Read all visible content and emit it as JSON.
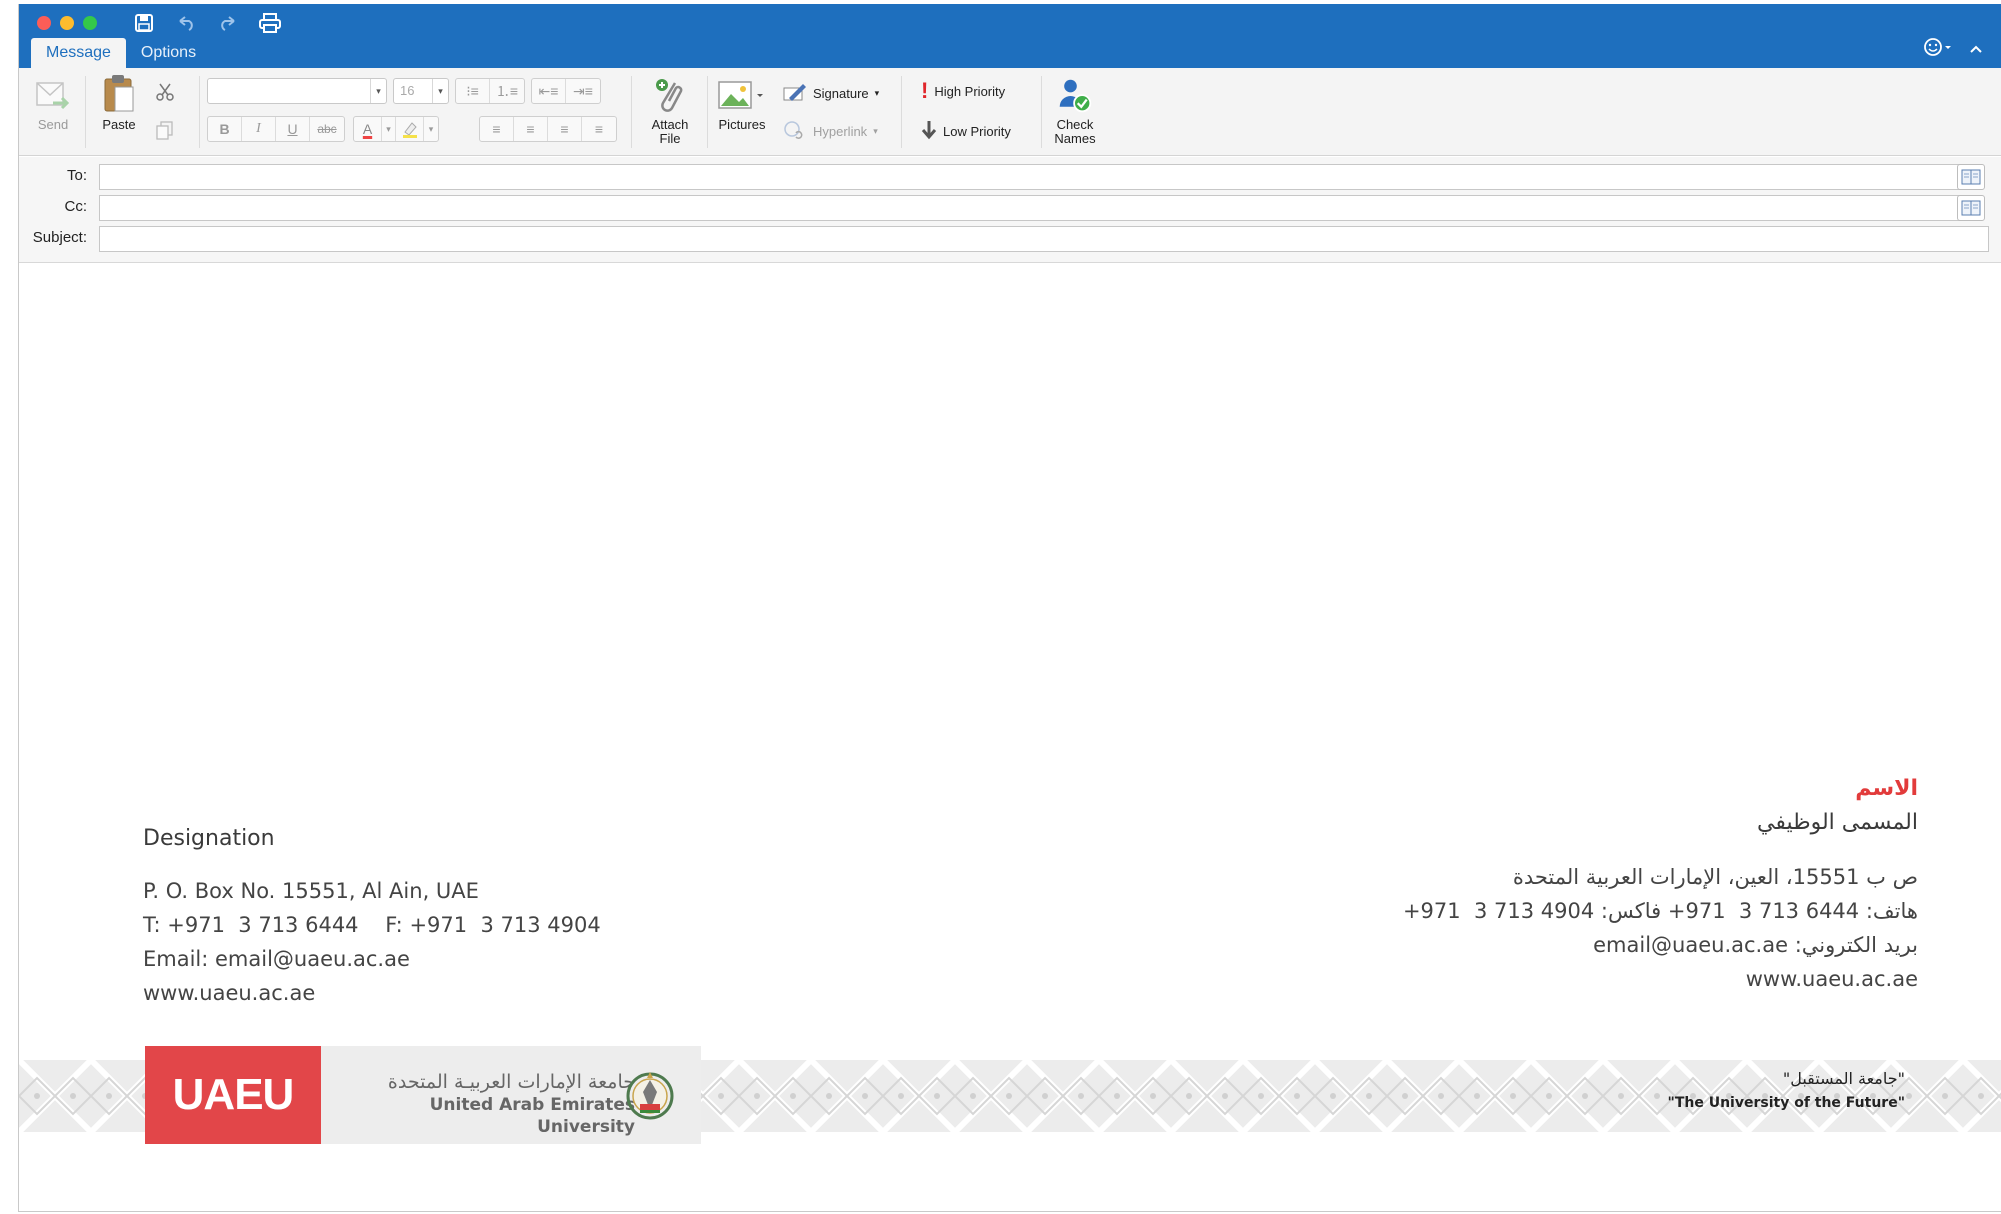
{
  "window": {
    "tabs": [
      {
        "label": "Message",
        "active": true
      },
      {
        "label": "Options",
        "active": false
      }
    ]
  },
  "ribbon": {
    "send_label": "Send",
    "paste_label": "Paste",
    "font_size": "16",
    "attach_label_1": "Attach",
    "attach_label_2": "File",
    "pictures_label": "Pictures",
    "signature_label": "Signature",
    "hyperlink_label": "Hyperlink",
    "high_priority_label": "High Priority",
    "low_priority_label": "Low Priority",
    "check_names_label_1": "Check",
    "check_names_label_2": "Names",
    "format_bold": "B",
    "format_italic": "I",
    "format_underline": "U",
    "format_strike": "abc",
    "font_color_glyph": "A"
  },
  "header": {
    "to_label": "To:",
    "cc_label": "Cc:",
    "subject_label": "Subject:",
    "to_value": "",
    "cc_value": "",
    "subject_value": ""
  },
  "signature_en": {
    "designation": "Designation",
    "address": "P. O. Box No. 15551, Al Ain, UAE",
    "phone": "T: +971  3 713 6444    F: +971  3 713 4904",
    "email": "Email: email@uaeu.ac.ae",
    "web": "www.uaeu.ac.ae"
  },
  "signature_ar": {
    "name": "الاسم",
    "designation": "المسمى الوظيفي",
    "address": "ص ب 15551، العين، الإمارات العربية المتحدة",
    "phone_label": "هاتف:",
    "phone": "+971  3 713 6444",
    "fax_label": "فاكس:",
    "fax": "+971  3 713 4904",
    "email_label": "بريد الكتروني:",
    "email": "email@uaeu.ac.ae",
    "web": "www.uaeu.ac.ae"
  },
  "banner": {
    "logo_abbrev": "UAEU",
    "university_ar": "جامعة الإمارات العربيـة المتحدة",
    "university_en": "United Arab Emirates University",
    "tagline_ar": "\"جامعة المستقبل\"",
    "tagline_en": "\"The University of the Future\""
  },
  "colors": {
    "titlebar": "#1e6fbe",
    "accent_red": "#e24649",
    "name_red": "#e23b3b"
  }
}
